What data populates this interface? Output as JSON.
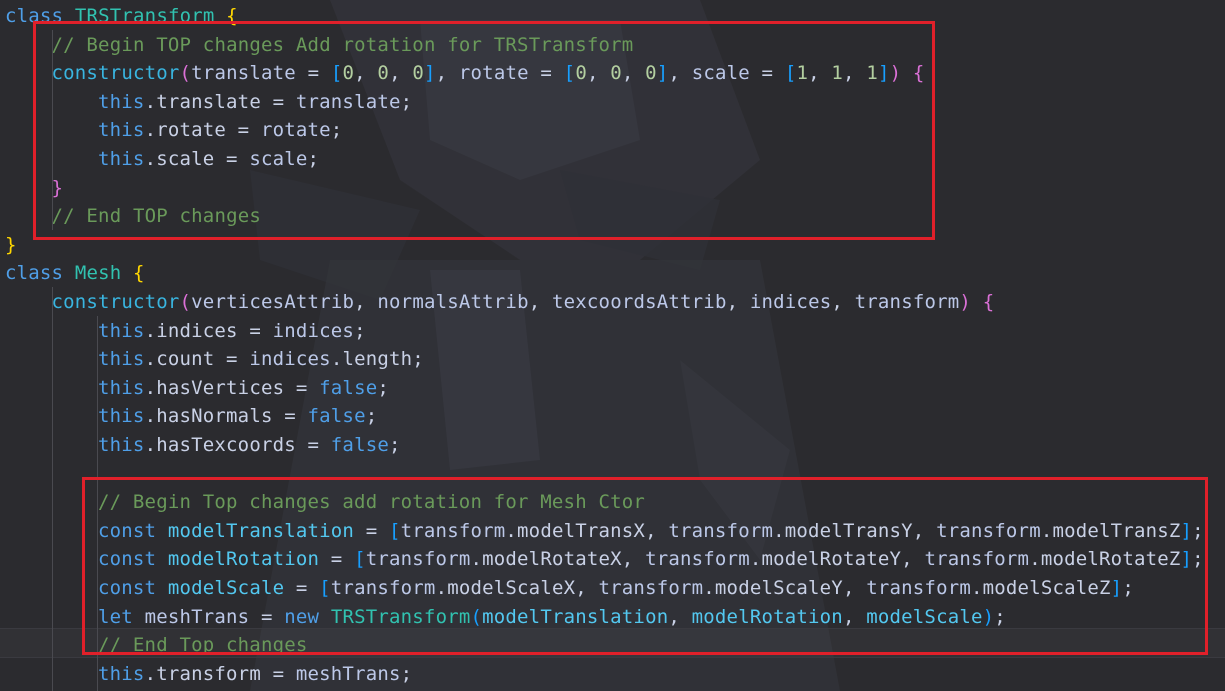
{
  "editor": {
    "lines": [
      {
        "i": 0,
        "tokens": [
          {
            "t": "class ",
            "c": "kw"
          },
          {
            "t": "TRSTransform",
            "c": "cls"
          },
          {
            "t": " ",
            "c": "op"
          },
          {
            "t": "{",
            "c": "p1"
          }
        ]
      },
      {
        "i": 1,
        "tokens": [
          {
            "t": "// Begin TOP changes Add rotation for TRSTransform",
            "c": "cm"
          }
        ]
      },
      {
        "i": 1,
        "tokens": [
          {
            "t": "constructor",
            "c": "ctor"
          },
          {
            "t": "(",
            "c": "p2"
          },
          {
            "t": "translate",
            "c": "id"
          },
          {
            "t": " = ",
            "c": "op"
          },
          {
            "t": "[",
            "c": "p3"
          },
          {
            "t": "0",
            "c": "num"
          },
          {
            "t": ", ",
            "c": "op"
          },
          {
            "t": "0",
            "c": "num"
          },
          {
            "t": ", ",
            "c": "op"
          },
          {
            "t": "0",
            "c": "num"
          },
          {
            "t": "]",
            "c": "p3"
          },
          {
            "t": ", ",
            "c": "op"
          },
          {
            "t": "rotate",
            "c": "id"
          },
          {
            "t": " = ",
            "c": "op"
          },
          {
            "t": "[",
            "c": "p3"
          },
          {
            "t": "0",
            "c": "num"
          },
          {
            "t": ", ",
            "c": "op"
          },
          {
            "t": "0",
            "c": "num"
          },
          {
            "t": ", ",
            "c": "op"
          },
          {
            "t": "0",
            "c": "num"
          },
          {
            "t": "]",
            "c": "p3"
          },
          {
            "t": ", ",
            "c": "op"
          },
          {
            "t": "scale",
            "c": "id"
          },
          {
            "t": " = ",
            "c": "op"
          },
          {
            "t": "[",
            "c": "p3"
          },
          {
            "t": "1",
            "c": "num"
          },
          {
            "t": ", ",
            "c": "op"
          },
          {
            "t": "1",
            "c": "num"
          },
          {
            "t": ", ",
            "c": "op"
          },
          {
            "t": "1",
            "c": "num"
          },
          {
            "t": "]",
            "c": "p3"
          },
          {
            "t": ")",
            "c": "p2"
          },
          {
            "t": " ",
            "c": "op"
          },
          {
            "t": "{",
            "c": "p2"
          }
        ]
      },
      {
        "i": 2,
        "tokens": [
          {
            "t": "this",
            "c": "kw"
          },
          {
            "t": ".translate = ",
            "c": "op"
          },
          {
            "t": "translate",
            "c": "id"
          },
          {
            "t": ";",
            "c": "op"
          }
        ]
      },
      {
        "i": 2,
        "tokens": [
          {
            "t": "this",
            "c": "kw"
          },
          {
            "t": ".rotate = ",
            "c": "op"
          },
          {
            "t": "rotate",
            "c": "id"
          },
          {
            "t": ";",
            "c": "op"
          }
        ]
      },
      {
        "i": 2,
        "tokens": [
          {
            "t": "this",
            "c": "kw"
          },
          {
            "t": ".scale = ",
            "c": "op"
          },
          {
            "t": "scale",
            "c": "id"
          },
          {
            "t": ";",
            "c": "op"
          }
        ]
      },
      {
        "i": 1,
        "tokens": [
          {
            "t": "}",
            "c": "p2"
          }
        ]
      },
      {
        "i": 1,
        "tokens": [
          {
            "t": "// End TOP changes",
            "c": "cm"
          }
        ]
      },
      {
        "i": 0,
        "tokens": [
          {
            "t": "}",
            "c": "p1"
          }
        ]
      },
      {
        "i": 0,
        "tokens": [
          {
            "t": "class ",
            "c": "kw"
          },
          {
            "t": "Mesh",
            "c": "cls"
          },
          {
            "t": " ",
            "c": "op"
          },
          {
            "t": "{",
            "c": "p1"
          }
        ]
      },
      {
        "i": 1,
        "tokens": [
          {
            "t": "constructor",
            "c": "ctor"
          },
          {
            "t": "(",
            "c": "p2"
          },
          {
            "t": "verticesAttrib",
            "c": "id"
          },
          {
            "t": ", ",
            "c": "op"
          },
          {
            "t": "normalsAttrib",
            "c": "id"
          },
          {
            "t": ", ",
            "c": "op"
          },
          {
            "t": "texcoordsAttrib",
            "c": "id"
          },
          {
            "t": ", ",
            "c": "op"
          },
          {
            "t": "indices",
            "c": "id"
          },
          {
            "t": ", ",
            "c": "op"
          },
          {
            "t": "transform",
            "c": "id"
          },
          {
            "t": ")",
            "c": "p2"
          },
          {
            "t": " ",
            "c": "op"
          },
          {
            "t": "{",
            "c": "p2"
          }
        ]
      },
      {
        "i": 2,
        "tokens": [
          {
            "t": "this",
            "c": "kw"
          },
          {
            "t": ".indices = ",
            "c": "op"
          },
          {
            "t": "indices",
            "c": "id"
          },
          {
            "t": ";",
            "c": "op"
          }
        ]
      },
      {
        "i": 2,
        "tokens": [
          {
            "t": "this",
            "c": "kw"
          },
          {
            "t": ".count = ",
            "c": "op"
          },
          {
            "t": "indices",
            "c": "id"
          },
          {
            "t": ".length;",
            "c": "op"
          }
        ]
      },
      {
        "i": 2,
        "tokens": [
          {
            "t": "this",
            "c": "kw"
          },
          {
            "t": ".hasVertices = ",
            "c": "op"
          },
          {
            "t": "false",
            "c": "bool"
          },
          {
            "t": ";",
            "c": "op"
          }
        ]
      },
      {
        "i": 2,
        "tokens": [
          {
            "t": "this",
            "c": "kw"
          },
          {
            "t": ".hasNormals = ",
            "c": "op"
          },
          {
            "t": "false",
            "c": "bool"
          },
          {
            "t": ";",
            "c": "op"
          }
        ]
      },
      {
        "i": 2,
        "tokens": [
          {
            "t": "this",
            "c": "kw"
          },
          {
            "t": ".hasTexcoords = ",
            "c": "op"
          },
          {
            "t": "false",
            "c": "bool"
          },
          {
            "t": ";",
            "c": "op"
          }
        ]
      },
      {
        "i": 0,
        "tokens": []
      },
      {
        "i": 2,
        "tokens": [
          {
            "t": "// Begin Top changes add rotation for Mesh Ctor",
            "c": "cm"
          }
        ]
      },
      {
        "i": 2,
        "tokens": [
          {
            "t": "const ",
            "c": "kw"
          },
          {
            "t": "modelTranslation",
            "c": "var"
          },
          {
            "t": " = ",
            "c": "op"
          },
          {
            "t": "[",
            "c": "p3"
          },
          {
            "t": "transform",
            "c": "id"
          },
          {
            "t": ".modelTransX, ",
            "c": "op"
          },
          {
            "t": "transform",
            "c": "id"
          },
          {
            "t": ".modelTransY, ",
            "c": "op"
          },
          {
            "t": "transform",
            "c": "id"
          },
          {
            "t": ".modelTransZ",
            "c": "op"
          },
          {
            "t": "]",
            "c": "p3"
          },
          {
            "t": ";",
            "c": "op"
          }
        ]
      },
      {
        "i": 2,
        "tokens": [
          {
            "t": "const ",
            "c": "kw"
          },
          {
            "t": "modelRotation",
            "c": "var"
          },
          {
            "t": " = ",
            "c": "op"
          },
          {
            "t": "[",
            "c": "p3"
          },
          {
            "t": "transform",
            "c": "id"
          },
          {
            "t": ".modelRotateX, ",
            "c": "op"
          },
          {
            "t": "transform",
            "c": "id"
          },
          {
            "t": ".modelRotateY, ",
            "c": "op"
          },
          {
            "t": "transform",
            "c": "id"
          },
          {
            "t": ".modelRotateZ",
            "c": "op"
          },
          {
            "t": "]",
            "c": "p3"
          },
          {
            "t": ";",
            "c": "op"
          }
        ]
      },
      {
        "i": 2,
        "tokens": [
          {
            "t": "const ",
            "c": "kw"
          },
          {
            "t": "modelScale",
            "c": "var"
          },
          {
            "t": " = ",
            "c": "op"
          },
          {
            "t": "[",
            "c": "p3"
          },
          {
            "t": "transform",
            "c": "id"
          },
          {
            "t": ".modelScaleX, ",
            "c": "op"
          },
          {
            "t": "transform",
            "c": "id"
          },
          {
            "t": ".modelScaleY, ",
            "c": "op"
          },
          {
            "t": "transform",
            "c": "id"
          },
          {
            "t": ".modelScaleZ",
            "c": "op"
          },
          {
            "t": "]",
            "c": "p3"
          },
          {
            "t": ";",
            "c": "op"
          }
        ]
      },
      {
        "i": 2,
        "tokens": [
          {
            "t": "let ",
            "c": "kw"
          },
          {
            "t": "meshTrans",
            "c": "id"
          },
          {
            "t": " = ",
            "c": "op"
          },
          {
            "t": "new ",
            "c": "kw"
          },
          {
            "t": "TRSTransform",
            "c": "cls"
          },
          {
            "t": "(",
            "c": "p3"
          },
          {
            "t": "modelTranslation",
            "c": "var"
          },
          {
            "t": ", ",
            "c": "op"
          },
          {
            "t": "modelRotation",
            "c": "var"
          },
          {
            "t": ", ",
            "c": "op"
          },
          {
            "t": "modelScale",
            "c": "var"
          },
          {
            "t": ")",
            "c": "p3"
          },
          {
            "t": ";",
            "c": "op"
          }
        ]
      },
      {
        "i": 2,
        "tokens": [
          {
            "t": "// End Top changes",
            "c": "cm"
          }
        ]
      },
      {
        "i": 2,
        "tokens": [
          {
            "t": "this",
            "c": "kw"
          },
          {
            "t": ".transform = ",
            "c": "op"
          },
          {
            "t": "meshTrans",
            "c": "id"
          },
          {
            "t": ";",
            "c": "op"
          }
        ]
      }
    ]
  },
  "highlights": {
    "color": "#e0202a"
  }
}
